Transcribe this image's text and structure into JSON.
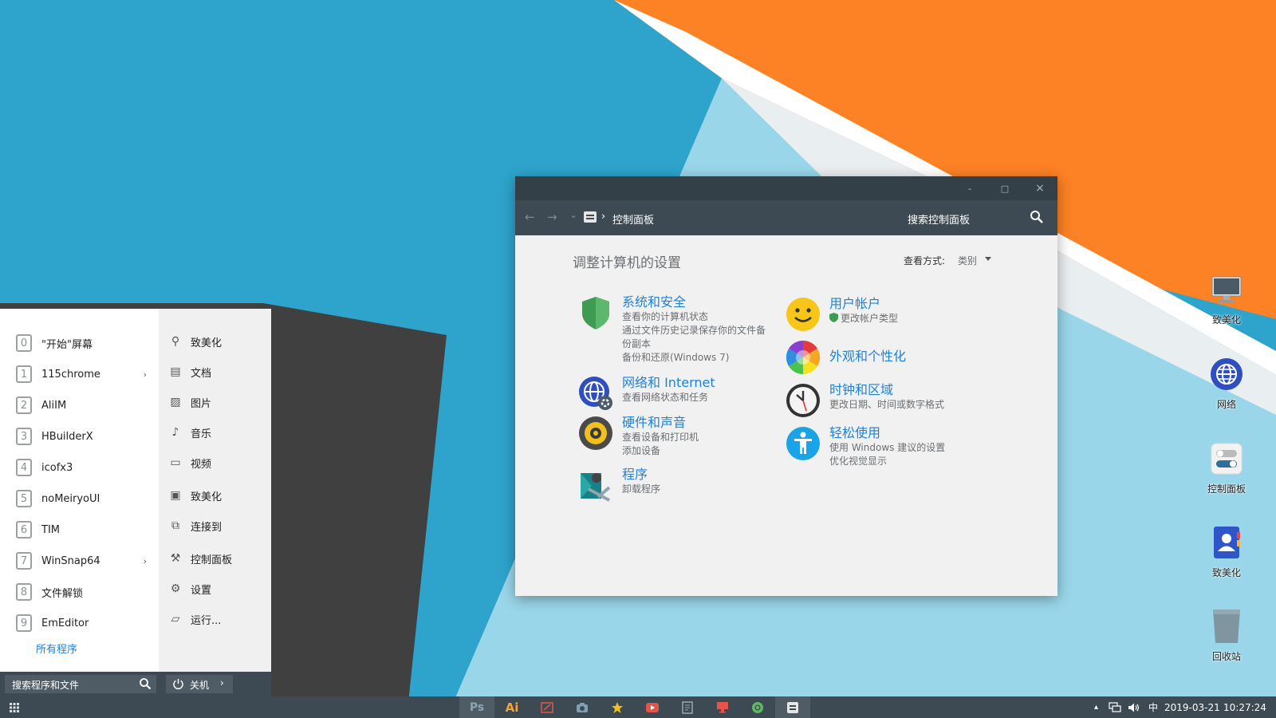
{
  "desktop": {
    "icons": [
      {
        "label": "致美化",
        "icon": "monitor-icon"
      },
      {
        "label": "网络",
        "icon": "globe-icon"
      },
      {
        "label": "控制面板",
        "icon": "toggle-icon"
      },
      {
        "label": "致美化",
        "icon": "user-card-icon"
      },
      {
        "label": "回收站",
        "icon": "trash-icon"
      }
    ]
  },
  "control_panel": {
    "window_buttons": {
      "minimize": "–",
      "maximize": "□",
      "close": "×"
    },
    "nav": {
      "back": "←",
      "forward": "→",
      "dropdown": "⌄"
    },
    "address_separator": "›",
    "address": "控制面板",
    "search_placeholder": "搜索控制面板",
    "heading": "调整计算机的设置",
    "view_by_label": "查看方式:",
    "view_by_value": "类别",
    "categories": [
      {
        "title": "系统和安全",
        "icon": "shield-icon",
        "links": [
          "查看你的计算机状态",
          "通过文件历史记录保存你的文件备",
          "份副本",
          "备份和还原(Windows 7)"
        ]
      },
      {
        "title": "网络和 Internet",
        "icon": "network-globe-icon",
        "links": [
          "查看网络状态和任务"
        ]
      },
      {
        "title": "硬件和声音",
        "icon": "speaker-icon",
        "links": [
          "查看设备和打印机",
          "添加设备"
        ]
      },
      {
        "title": "程序",
        "icon": "programs-icon",
        "links": [
          "卸载程序"
        ]
      },
      {
        "title": "用户帐户",
        "icon": "smiley-icon",
        "links": [
          "更改帐户类型"
        ]
      },
      {
        "title": "外观和个性化",
        "icon": "color-wheel-icon",
        "links": []
      },
      {
        "title": "时钟和区域",
        "icon": "clock-icon",
        "links": [
          "更改日期、时间或数字格式"
        ]
      },
      {
        "title": "轻松使用",
        "icon": "accessibility-icon",
        "links": [
          "使用 Windows 建议的设置",
          "优化视觉显示"
        ]
      }
    ]
  },
  "start_menu": {
    "apps": [
      {
        "label": "\"开始\"屏幕",
        "glyph": "0",
        "has_submenu": false
      },
      {
        "label": "115chrome",
        "glyph": "1",
        "has_submenu": true
      },
      {
        "label": "AliIM",
        "glyph": "2",
        "has_submenu": false
      },
      {
        "label": "HBuilderX",
        "glyph": "3",
        "has_submenu": false
      },
      {
        "label": "icofx3",
        "glyph": "4",
        "has_submenu": false
      },
      {
        "label": "noMeiryoUI",
        "glyph": "5",
        "has_submenu": false
      },
      {
        "label": "TIM",
        "glyph": "6",
        "has_submenu": false
      },
      {
        "label": "WinSnap64",
        "glyph": "7",
        "has_submenu": true
      },
      {
        "label": "文件解锁",
        "glyph": "8",
        "has_submenu": false
      },
      {
        "label": "EmEditor",
        "glyph": "9",
        "has_submenu": false
      }
    ],
    "submenu_arrow": "›",
    "all_programs": "所有程序",
    "places": [
      {
        "label": "致美化",
        "icon": "user-icon",
        "glyph": "⚲"
      },
      {
        "label": "文档",
        "icon": "document-icon",
        "glyph": "▤"
      },
      {
        "label": "图片",
        "icon": "picture-icon",
        "glyph": "▨"
      },
      {
        "label": "音乐",
        "icon": "music-icon",
        "glyph": "♪"
      },
      {
        "label": "视频",
        "icon": "video-icon",
        "glyph": "▭"
      },
      {
        "label": "致美化",
        "icon": "computer-icon",
        "glyph": "▣"
      },
      {
        "label": "连接到",
        "icon": "connect-icon",
        "glyph": "⧉"
      },
      {
        "label": "控制面板",
        "icon": "wrench-icon",
        "glyph": "⚒"
      },
      {
        "label": "设置",
        "icon": "gear-icon",
        "glyph": "⚙"
      },
      {
        "label": "运行...",
        "icon": "run-icon",
        "glyph": "▱"
      }
    ],
    "search_placeholder": "搜索程序和文件",
    "shutdown_label": "关机",
    "shutdown_arrow": "›"
  },
  "taskbar": {
    "apps": [
      {
        "label": "Ps",
        "icon": "photoshop-icon"
      },
      {
        "label": "Ai",
        "icon": "illustrator-icon"
      },
      {
        "label": "",
        "icon": "screenshot-icon"
      },
      {
        "label": "",
        "icon": "camera-icon"
      },
      {
        "label": "",
        "icon": "star-icon"
      },
      {
        "label": "",
        "icon": "video-player-icon"
      },
      {
        "label": "",
        "icon": "notepad-icon"
      },
      {
        "label": "",
        "icon": "remote-desktop-icon"
      },
      {
        "label": "",
        "icon": "chrome-icon"
      },
      {
        "label": "",
        "icon": "control-panel-icon"
      }
    ],
    "tray": {
      "chevron": "▴",
      "volume": "🔈︎",
      "ime": "中",
      "date": "2019-03-21",
      "time": "10:27:24"
    }
  },
  "colors": {
    "accent_blue": "#1e82d8",
    "wallpaper_dark": "#404040",
    "wallpaper_blue": "#2ea3cb",
    "wallpaper_light_blue": "#99d6e9",
    "wallpaper_orange": "#fd8125",
    "taskbar": "#3d4a53"
  }
}
